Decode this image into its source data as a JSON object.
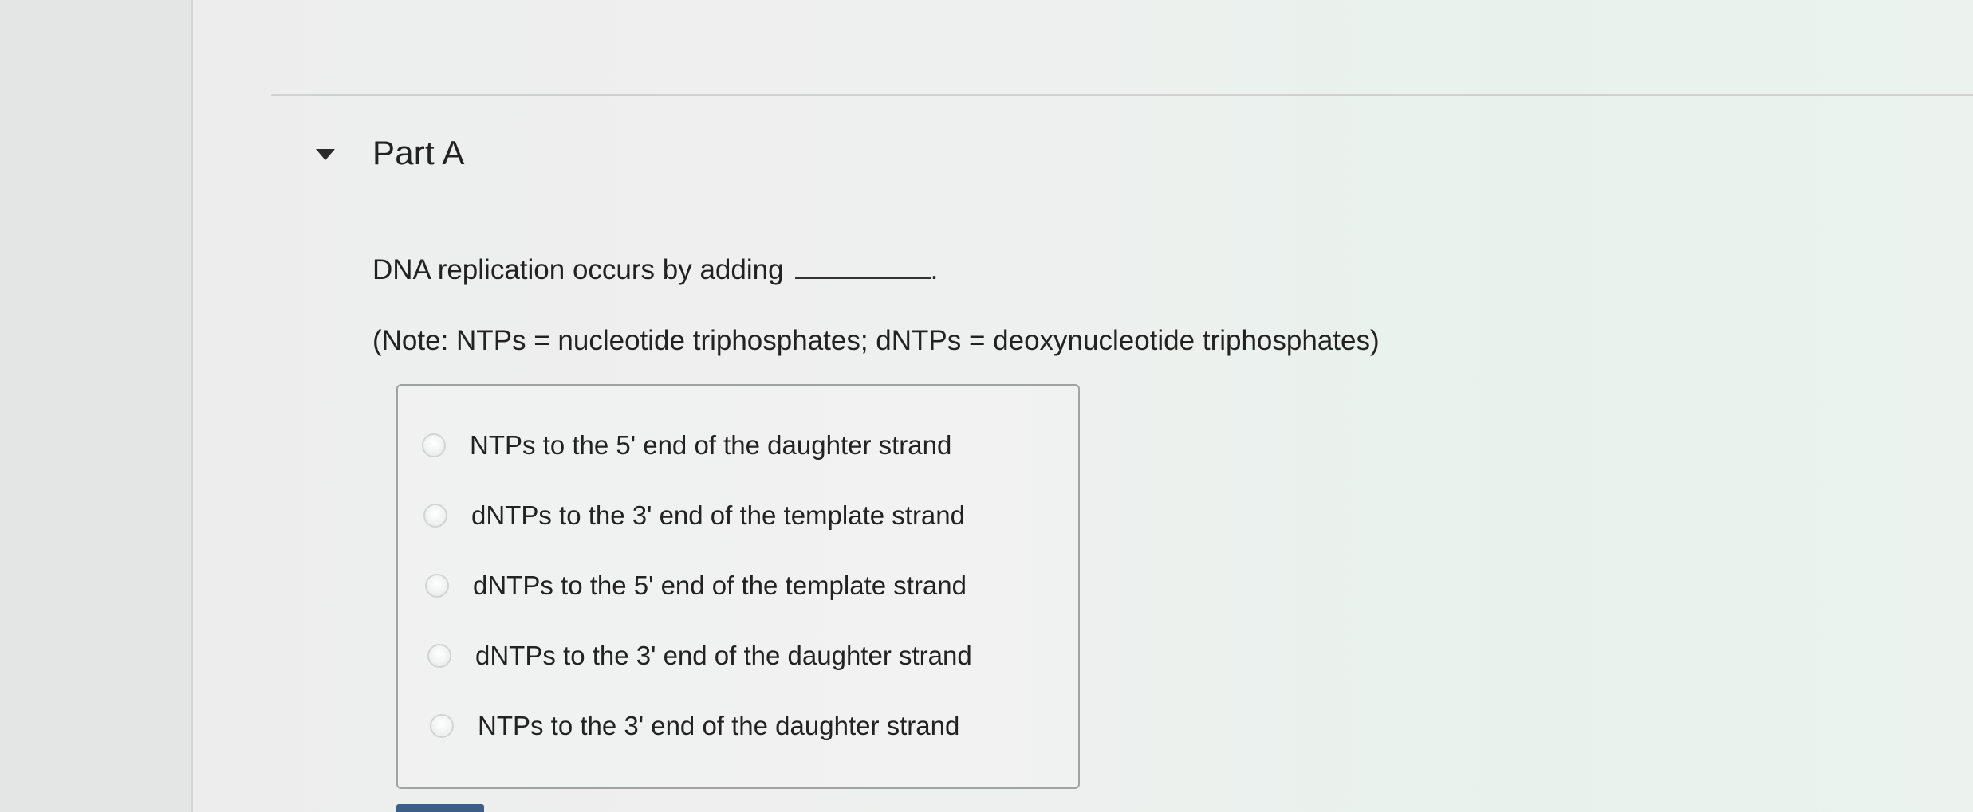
{
  "part": {
    "title": "Part A",
    "toggle_icon": "triangle-down-icon"
  },
  "question": {
    "stem": "DNA replication occurs by adding",
    "blank_suffix": ".",
    "note": "(Note:   NTPs = nucleotide triphosphates;    dNTPs = deoxynucleotide triphosphates)"
  },
  "options": [
    {
      "label": "NTPs to the 5' end of the daughter strand",
      "selected": false
    },
    {
      "label": "dNTPs to the 3' end of the template strand",
      "selected": false
    },
    {
      "label": "dNTPs to the 5' end of the template strand",
      "selected": false
    },
    {
      "label": "dNTPs to the 3' end of the daughter strand",
      "selected": false
    },
    {
      "label": "NTPs to the 3' end of the daughter strand",
      "selected": false
    }
  ],
  "colors": {
    "text": "#222222",
    "box_border": "#9ea3a3",
    "accent": "#3d5f86"
  }
}
